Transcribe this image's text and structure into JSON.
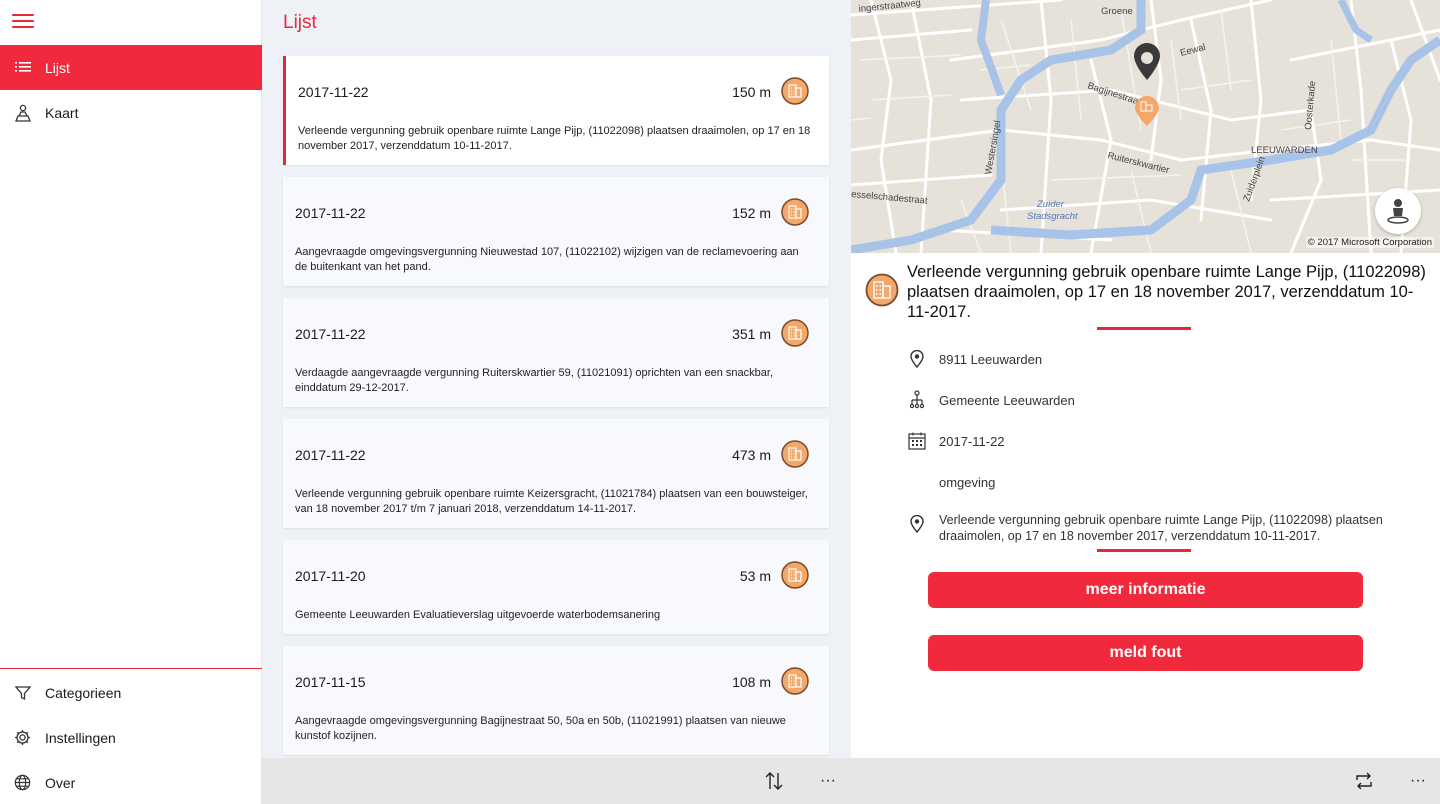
{
  "nav": {
    "items": [
      {
        "label": "Lijst",
        "icon": "list-icon",
        "active": true
      },
      {
        "label": "Kaart",
        "icon": "map-pin-person-icon",
        "active": false
      }
    ],
    "bottom_items": [
      {
        "label": "Categorieen",
        "icon": "filter-icon"
      },
      {
        "label": "Instellingen",
        "icon": "gear-icon"
      },
      {
        "label": "Over",
        "icon": "globe-icon"
      }
    ]
  },
  "list": {
    "title": "Lijst",
    "items": [
      {
        "date": "2017-11-22",
        "distance": "150 m",
        "description": "Verleende vergunning gebruik openbare ruimte Lange Pijp, (11022098) plaatsen draaimolen, op 17 en 18 november 2017, verzenddatum 10-11-2017.",
        "selected": true
      },
      {
        "date": "2017-11-22",
        "distance": "152 m",
        "description": "Aangevraagde omgevingsvergunning Nieuwestad 107, (11022102) wijzigen van de reclamevoering aan de buitenkant van het pand.",
        "selected": false
      },
      {
        "date": "2017-11-22",
        "distance": "351 m",
        "description": "Verdaagde aangevraagde vergunning Ruiterskwartier 59, (11021091) oprichten van een snackbar, einddatum 29-12-2017.",
        "selected": false
      },
      {
        "date": "2017-11-22",
        "distance": "473 m",
        "description": "Verleende vergunning gebruik openbare ruimte Keizersgracht, (11021784) plaatsen van een bouwsteiger, van 18 november 2017 t/m 7 januari 2018, verzenddatum 14-11-2017.",
        "selected": false
      },
      {
        "date": "2017-11-20",
        "distance": "53 m",
        "description": "Gemeente Leeuwarden Evaluatieverslag uitgevoerde waterbodemsanering",
        "selected": false
      },
      {
        "date": "2017-11-15",
        "distance": "108 m",
        "description": "Aangevraagde omgevingsvergunning Bagijnestraat 50, 50a en 50b, (11021991) plaatsen van nieuwe kunstof kozijnen.",
        "selected": false
      }
    ]
  },
  "map": {
    "labels": {
      "street_top": "ingerstraatweg",
      "groene": "Groene",
      "eewal": "Eewal",
      "bagijnestraat": "Bagijnestraat",
      "westersingel": "Westersingel",
      "ruiterskwartier": "Ruiterskwartier",
      "oosterkade": "Oosterkade",
      "leeuwarden": "LEEUWARDEN",
      "esselschade": "esselschadestraat",
      "zuider": "Zuider",
      "stadsgracht": "Stadsgracht",
      "zuiderplein": "Zuiderplein"
    },
    "credit": "© 2017 Microsoft Corporation"
  },
  "detail": {
    "title": "Verleende vergunning gebruik openbare ruimte Lange Pijp, (11022098) plaatsen draaimolen, op 17 en 18 november 2017, verzenddatum 10-11-2017.",
    "location": "8911 Leeuwarden",
    "organization": "Gemeente Leeuwarden",
    "date": "2017-11-22",
    "category": "omgeving",
    "address_text": "Verleende vergunning gebruik openbare ruimte Lange Pijp, (11022098) plaatsen draaimolen, op 17 en 18 november 2017, verzenddatum 10-11-2017.",
    "more_info_label": "meer informatie",
    "report_error_label": "meld fout"
  },
  "commandbar": {
    "sort_icon": "sort-icon",
    "more_icon": "more-icon",
    "more_label": "···",
    "repeat_icon": "repeat-icon"
  },
  "colors": {
    "accent": "#f02a3c",
    "badge_fill": "#f3a86a",
    "badge_ring": "#7a4a2a",
    "list_bg": "#eef2f7"
  }
}
